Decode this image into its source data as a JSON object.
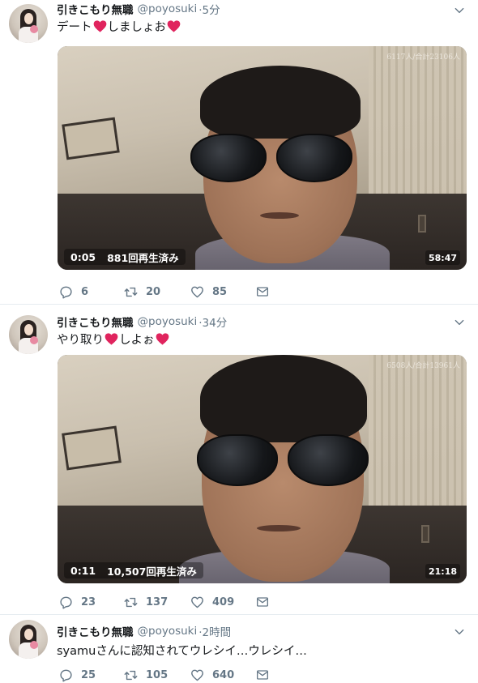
{
  "colors": {
    "heart": "#e0245e",
    "secondary_text": "#657786",
    "divider": "#e6ecf0"
  },
  "tweets": [
    {
      "display_name": "引きこもり無職",
      "handle": "@poyosuki",
      "time": "·5分",
      "text_parts": [
        "デート",
        "しましょお"
      ],
      "heart_icon": "red-heart-icon",
      "video": {
        "watermark": "6117人/合計23106人",
        "elapsed": "0:05",
        "views": "881回再生済み",
        "duration": "58:47"
      },
      "replies": "6",
      "retweets": "20",
      "likes": "85"
    },
    {
      "display_name": "引きこもり無職",
      "handle": "@poyosuki",
      "time": "·34分",
      "text_parts": [
        "やり取り",
        "しよぉ"
      ],
      "heart_icon": "red-heart-icon",
      "video": {
        "watermark": "6508人/合計13961人",
        "elapsed": "0:11",
        "views": "10,507回再生済み",
        "duration": "21:18"
      },
      "replies": "23",
      "retweets": "137",
      "likes": "409"
    },
    {
      "display_name": "引きこもり無職",
      "handle": "@poyosuki",
      "time": "·2時間",
      "text": "syamuさんに認知されてウレシイ…ウレシイ…",
      "replies": "25",
      "retweets": "105",
      "likes": "640"
    }
  ],
  "icons": {
    "reply": "reply-icon",
    "retweet": "retweet-icon",
    "like": "like-icon",
    "dm": "direct-message-icon",
    "menu": "chevron-down-icon"
  }
}
